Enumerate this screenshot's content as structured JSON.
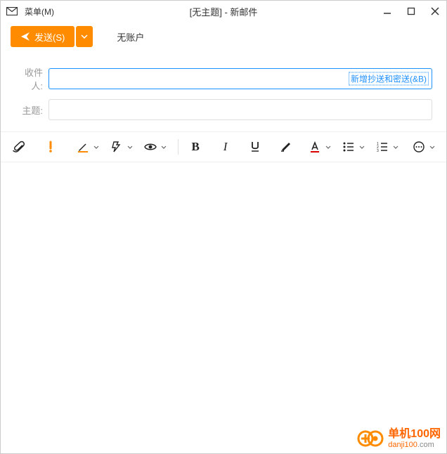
{
  "titlebar": {
    "menu": "菜单(M)",
    "title": "[无主题] - 新邮件"
  },
  "actions": {
    "send": "发送(S)",
    "no_account": "无账户"
  },
  "fields": {
    "recipient_label": "收件人:",
    "subject_label": "主题:",
    "cc_bcc_link": "新增抄送和密送(&B)"
  },
  "watermark": {
    "line1": "单机100网",
    "line2a": "danji100",
    "line2b": ".com"
  }
}
